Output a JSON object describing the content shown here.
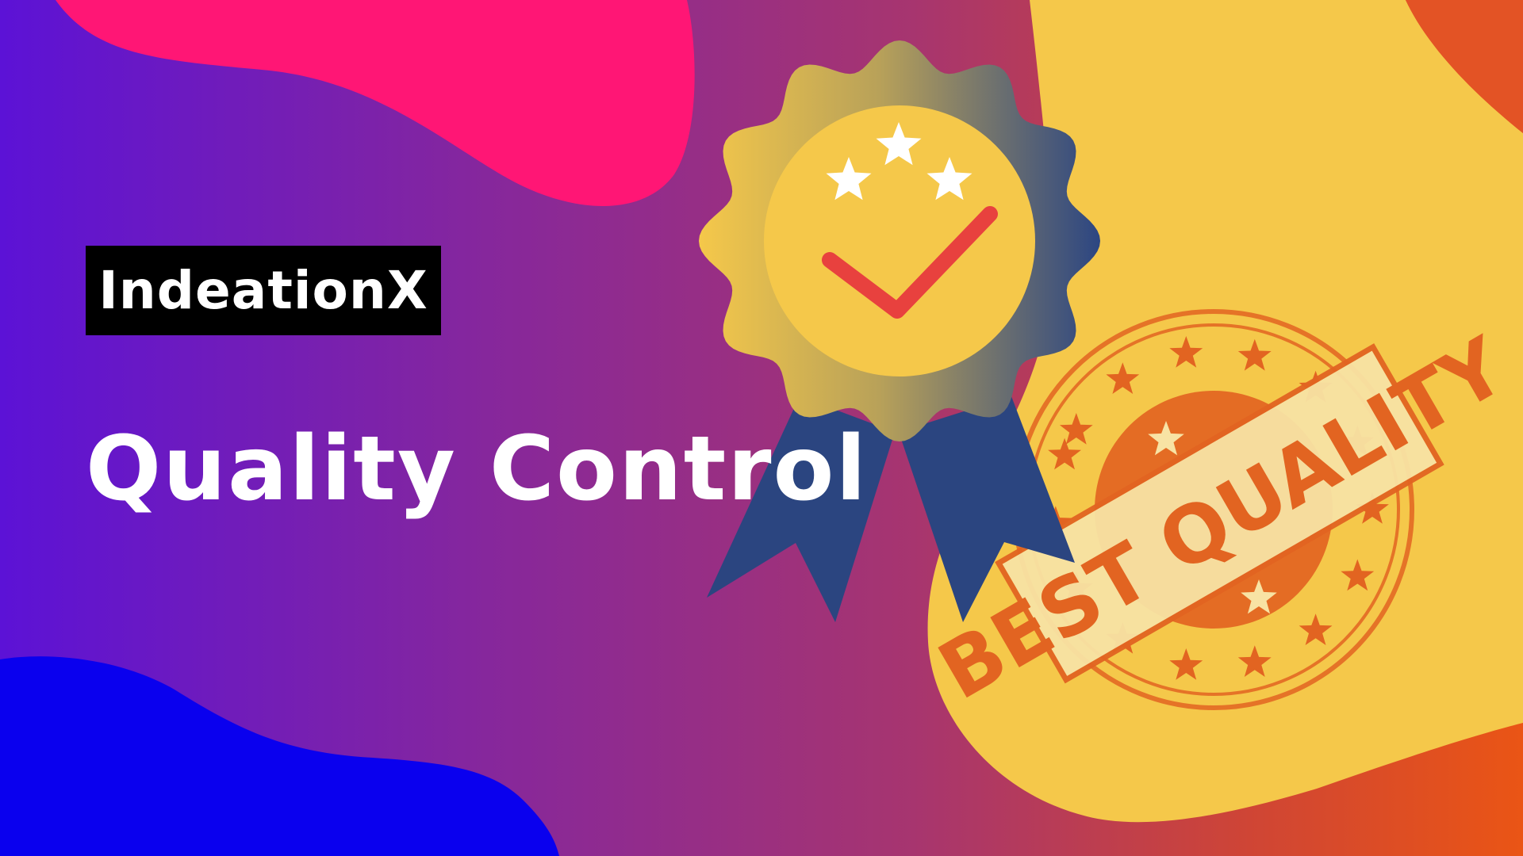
{
  "brand": {
    "name": "IndeationX"
  },
  "headline": {
    "text": "Quality Control"
  },
  "stamp": {
    "text": "BEST QUALITY"
  },
  "colors": {
    "pink": "#ff1675",
    "yellow": "#f5c84a",
    "blue": "#0a00ee",
    "stamp_orange": "#e26421",
    "stamp_cream": "#f8e3a4",
    "ribbon_navy": "#2b4580",
    "check_red": "#e8413e"
  },
  "icons": [
    "award-badge-icon",
    "star-icon",
    "check-icon",
    "ribbon-icon",
    "quality-stamp-icon"
  ]
}
